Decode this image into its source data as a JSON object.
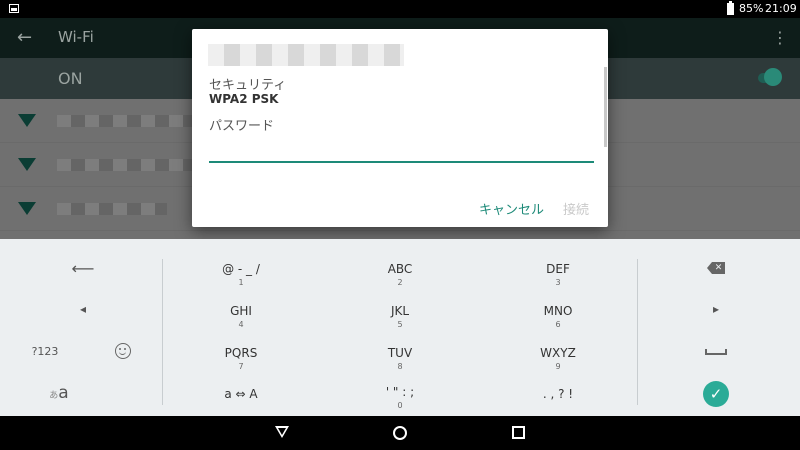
{
  "status_bar": {
    "battery_percent": "85%",
    "time": "21:09"
  },
  "toolbar": {
    "back_glyph": "←",
    "title": "Wi-Fi",
    "more_glyph": "⋮"
  },
  "wifi_toggle": {
    "label": "ON",
    "state": "on"
  },
  "network_list": {
    "rows": [
      {
        "name_blurred": true
      },
      {
        "name_blurred": true
      },
      {
        "name_blurred": true
      }
    ],
    "icon": "wifi-signal-icon"
  },
  "dialog": {
    "network_name_blurred": true,
    "security_label": "セキュリティ",
    "security_value": "WPA2 PSK",
    "password_label": "パスワード",
    "password_value": "",
    "cancel_label": "キャンセル",
    "connect_label": "接続"
  },
  "keyboard": {
    "left_keys": {
      "undo_glyph": "⟵",
      "cursor_left_glyph": "◂",
      "mode_label": "?123",
      "kana_label_small": "あ",
      "kana_label_large": "a"
    },
    "keys": [
      {
        "main": "@ - _ /",
        "sub": "1"
      },
      {
        "main": "ABC",
        "sub": "2"
      },
      {
        "main": "DEF",
        "sub": "3"
      },
      {
        "main": "GHI",
        "sub": "4"
      },
      {
        "main": "JKL",
        "sub": "5"
      },
      {
        "main": "MNO",
        "sub": "6"
      },
      {
        "main": "PQRS",
        "sub": "7"
      },
      {
        "main": "TUV",
        "sub": "8"
      },
      {
        "main": "WXYZ",
        "sub": "9"
      },
      {
        "main": "a ⇔ A",
        "sub": ""
      },
      {
        "main": "' \" : ;",
        "sub": "0"
      },
      {
        "main": ". , ? !",
        "sub": ""
      }
    ],
    "right_keys": {
      "cursor_right_glyph": "▸",
      "enter_glyph": "✓"
    }
  },
  "colors": {
    "accent": "#1d8a78",
    "enter_button": "#2bab97",
    "keyboard_bg": "#eceff1"
  }
}
